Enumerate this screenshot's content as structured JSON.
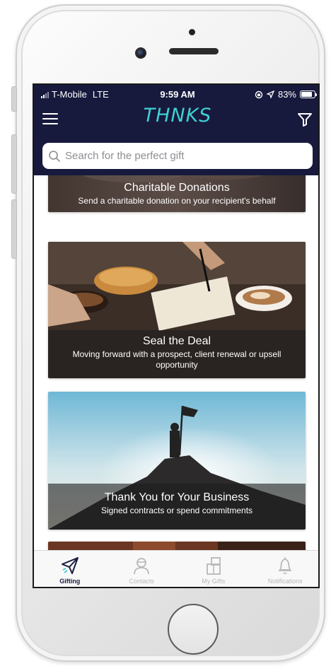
{
  "status_bar": {
    "carrier": "T-Mobile",
    "network": "LTE",
    "time": "9:59 AM",
    "battery": "83%",
    "battery_level": 0.83
  },
  "header": {
    "logo": "THNKS",
    "menu_icon": "hamburger-menu-icon",
    "filter_icon": "filter-funnel-icon"
  },
  "search": {
    "placeholder": "Search for the perfect gift",
    "value": ""
  },
  "cards": [
    {
      "title": "Charitable Donations",
      "subtitle": "Send a charitable donation on your recipient's behalf"
    },
    {
      "title": "Seal the Deal",
      "subtitle": "Moving forward with a prospect, client renewal or upsell opportunity"
    },
    {
      "title": "Thank You for Your Business",
      "subtitle": "Signed contracts or spend commitments"
    }
  ],
  "tabs": [
    {
      "label": "Gifting",
      "icon": "paper-plane-icon",
      "active": true
    },
    {
      "label": "Contacts",
      "icon": "person-icon",
      "active": false
    },
    {
      "label": "My Gifts",
      "icon": "gift-box-icon",
      "active": false
    },
    {
      "label": "Notifications",
      "icon": "bell-icon",
      "active": false
    }
  ],
  "colors": {
    "header_bg": "#171a3d",
    "logo_accent": "#3fd0d4",
    "active_tab": "#171a3d",
    "inactive_tab": "#b8b8b8"
  }
}
